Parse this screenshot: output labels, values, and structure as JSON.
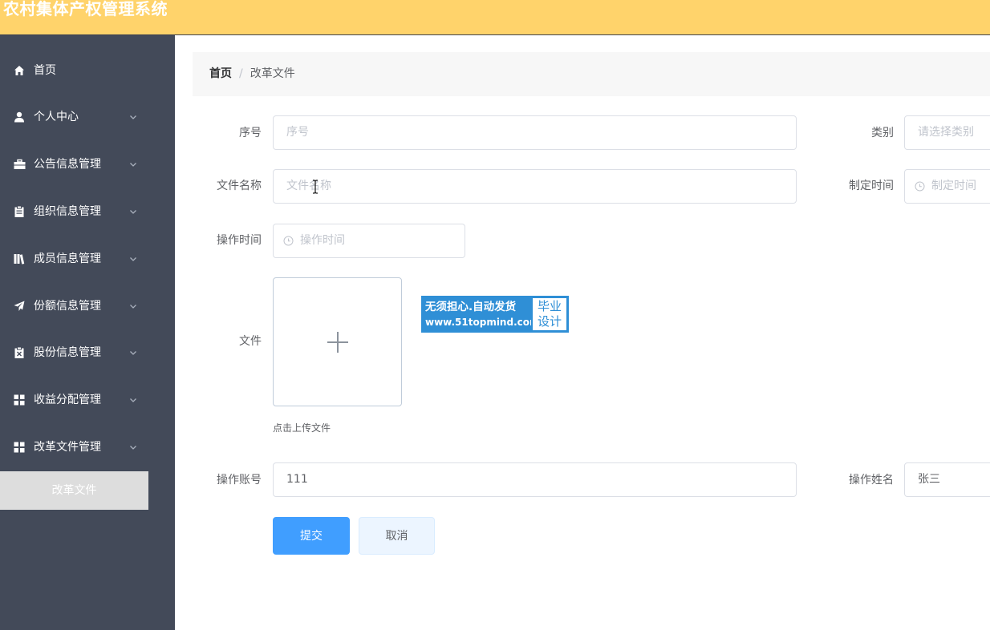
{
  "header": {
    "title": "农村集体产权管理系统",
    "bg_color": "#ffd36b"
  },
  "sidebar": {
    "items": [
      {
        "label": "首页",
        "icon": "home-icon",
        "has_chevron": false
      },
      {
        "label": "个人中心",
        "icon": "user-icon",
        "has_chevron": true
      },
      {
        "label": "公告信息管理",
        "icon": "briefcase-icon",
        "has_chevron": true
      },
      {
        "label": "组织信息管理",
        "icon": "clipboard-icon",
        "has_chevron": true
      },
      {
        "label": "成员信息管理",
        "icon": "library-icon",
        "has_chevron": true
      },
      {
        "label": "份额信息管理",
        "icon": "send-icon",
        "has_chevron": true
      },
      {
        "label": "股份信息管理",
        "icon": "clipboard-x-icon",
        "has_chevron": true
      },
      {
        "label": "收益分配管理",
        "icon": "grid-icon",
        "has_chevron": true
      },
      {
        "label": "改革文件管理",
        "icon": "grid-icon",
        "has_chevron": true
      }
    ],
    "active_subitem": "改革文件",
    "bg_color": "#434a59"
  },
  "breadcrumb": {
    "home": "首页",
    "separator": "/",
    "current": "改革文件"
  },
  "form": {
    "seq": {
      "label": "序号",
      "placeholder": "序号"
    },
    "category": {
      "label": "类别",
      "placeholder": "请选择类别"
    },
    "file_name": {
      "label": "文件名称",
      "placeholder": "文件名称"
    },
    "made_time": {
      "label": "制定时间",
      "placeholder": "制定时间"
    },
    "op_time": {
      "label": "操作时间",
      "placeholder": "操作时间"
    },
    "file": {
      "label": "文件",
      "upload_tip": "点击上传文件"
    },
    "op_account": {
      "label": "操作账号",
      "value": "111"
    },
    "op_name": {
      "label": "操作姓名",
      "value": "张三"
    }
  },
  "watermark": {
    "line1": "无须担心.自动发货",
    "line2": "www.51topmind.com",
    "right_line1": "毕业",
    "right_line2": "设计"
  },
  "buttons": {
    "submit": "提交",
    "cancel": "取消"
  },
  "colors": {
    "primary": "#409eff",
    "header": "#ffd36b",
    "sidebar": "#434a59",
    "watermark": "#2f8fd6"
  }
}
